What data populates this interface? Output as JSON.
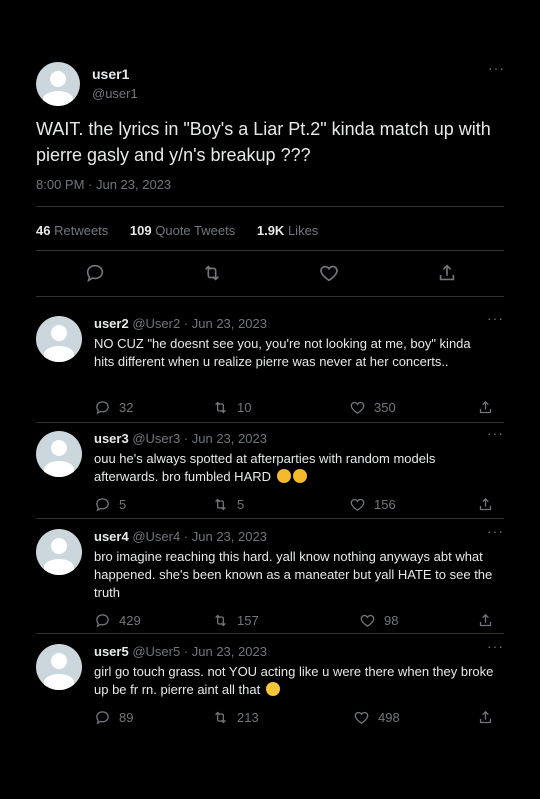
{
  "main": {
    "name": "user1",
    "handle": "@user1",
    "text": "WAIT. the lyrics in \"Boy's a Liar Pt.2\" kinda match up with pierre gasly and y/n's breakup ???",
    "time": "8:00 PM · Jun 23, 2023",
    "more": "···",
    "stats": {
      "retweets_count": "46",
      "retweets_label": "Retweets",
      "quotes_count": "109",
      "quotes_label": "Quote Tweets",
      "likes_count": "1.9K",
      "likes_label": "Likes"
    }
  },
  "replies": [
    {
      "name": "user2",
      "handle_date": "@User2 · Jun 23, 2023",
      "text": "NO CUZ \"he doesnt see you, you're not looking at me, boy\" kinda hits different when u realize pierre was never at her concerts..",
      "reply_count": "32",
      "retweet_count": "10",
      "like_count": "350"
    },
    {
      "name": "user3",
      "handle_date": "@User3 · Jun 23, 2023",
      "text": "ouu he's always spotted at afterparties with random models afterwards. bro fumbled HARD",
      "emoji": "crying-face-emoji ×2",
      "reply_count": "5",
      "retweet_count": "5",
      "like_count": "156"
    },
    {
      "name": "user4",
      "handle_date": "@User4 · Jun 23, 2023",
      "text": "bro imagine reaching this hard. yall know nothing anyways abt what happened. she's been known as a maneater but yall HATE to see the truth",
      "reply_count": "429",
      "retweet_count": "157",
      "like_count": "98"
    },
    {
      "name": "user5",
      "handle_date": "@User5 · Jun 23, 2023",
      "text": "girl go touch grass. not YOU acting like u were there when they broke up be fr rn. pierre aint all that",
      "emoji": "eye-roll-emoji",
      "reply_count": "89",
      "retweet_count": "213",
      "like_count": "498"
    }
  ],
  "colors": {
    "background": "#000000",
    "text": "#e7e9ea",
    "muted": "#71767b",
    "divider": "#2f3336",
    "avatar": "#ccd6dd"
  }
}
